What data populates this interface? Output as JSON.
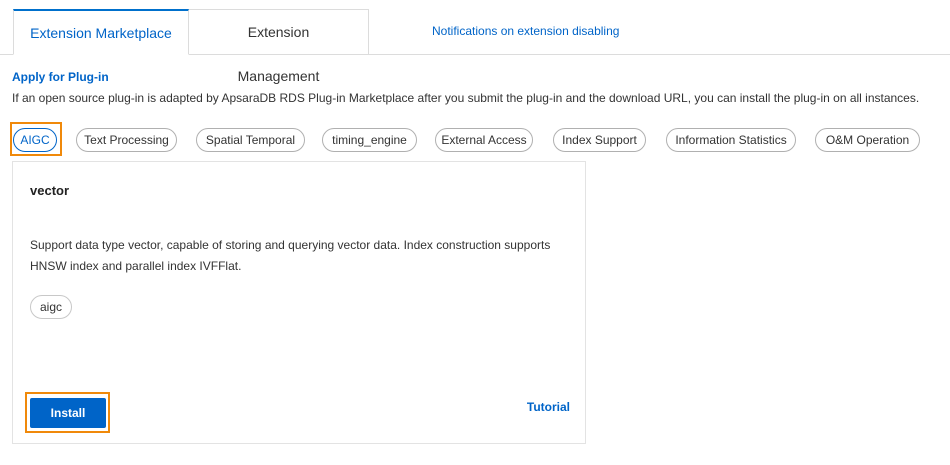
{
  "tabs": {
    "marketplace": "Extension Marketplace",
    "management": "Extension Management",
    "notifications_link": "Notifications on extension disabling"
  },
  "apply": {
    "link": "Apply for Plug-in",
    "description": "If an open source plug-in is adapted by ApsaraDB RDS Plug-in Marketplace after you submit the plug-in and the download URL, you can install the plug-in on all instances."
  },
  "filters": [
    {
      "label": "AIGC",
      "selected": true
    },
    {
      "label": "Text Processing",
      "selected": false
    },
    {
      "label": "Spatial Temporal",
      "selected": false
    },
    {
      "label": "timing_engine",
      "selected": false
    },
    {
      "label": "External Access",
      "selected": false
    },
    {
      "label": "Index Support",
      "selected": false
    },
    {
      "label": "Information Statistics",
      "selected": false
    },
    {
      "label": "O&M Operation",
      "selected": false
    }
  ],
  "card": {
    "title": "vector",
    "description": "Support data type vector, capable of storing and querying vector data. Index construction supports HNSW index and parallel index IVFFlat.",
    "tag": "aigc",
    "install_label": "Install",
    "tutorial_label": "Tutorial"
  },
  "colors": {
    "accent": "#0064c8",
    "highlight": "#f0890a"
  }
}
